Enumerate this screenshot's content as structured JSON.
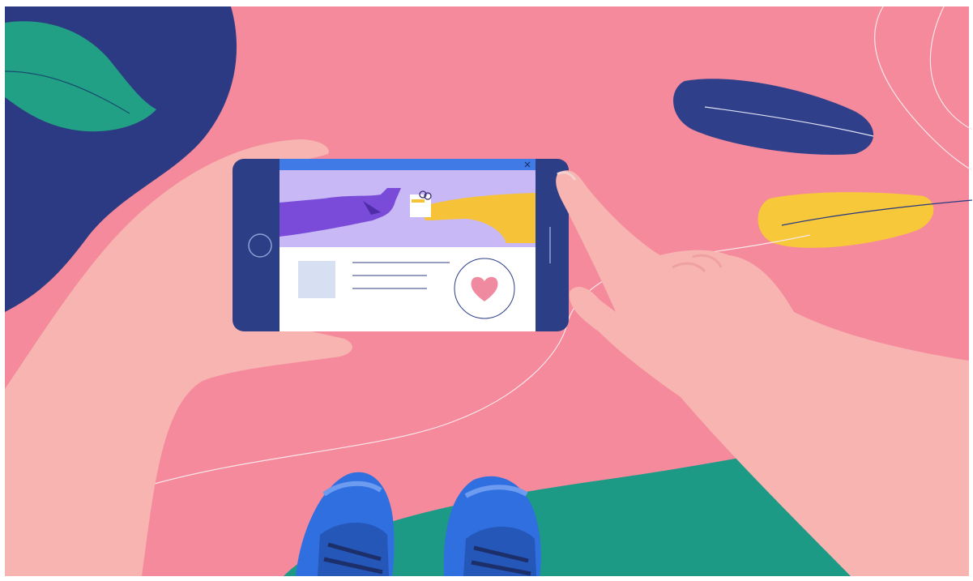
{
  "scene": {
    "description_words": [],
    "palette": {
      "background_pink": "#f48a9c",
      "navy": "#2b3a82",
      "teal": "#1d9a86",
      "green_leaf": "#22a085",
      "yellow_leaf": "#f7c83a",
      "skin": "#f7b4b0",
      "skin_shadow": "#eea19e",
      "phone_body": "#2c3f86",
      "phone_screen_top": "#3f7ae6",
      "hero_bg": "#c8b8f6",
      "purple_leg": "#7a4ad8",
      "yellow_leg": "#f5c238",
      "card_bg": "#ffffff",
      "thumb_box": "#d7dff3",
      "heart": "#f08aa0",
      "shoe_blue": "#2f6fe0"
    },
    "icons": {
      "heart_button": "heart-icon",
      "close_button": "close-icon",
      "home_button": "circle-button-icon"
    }
  }
}
